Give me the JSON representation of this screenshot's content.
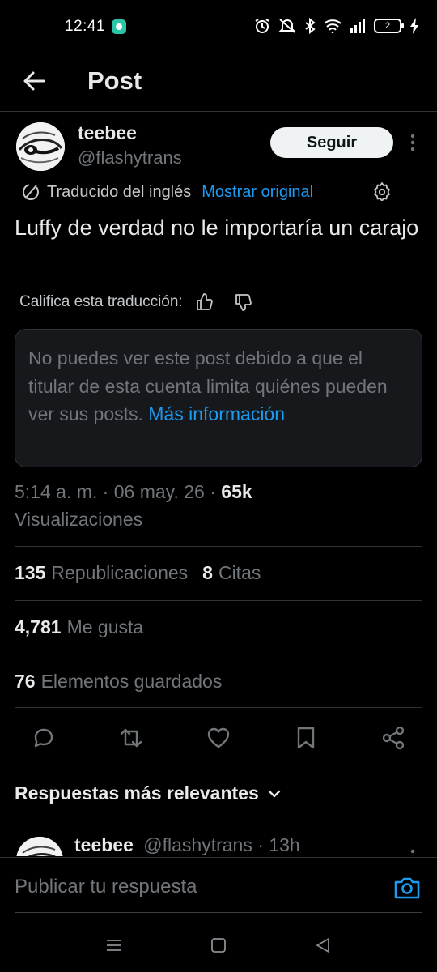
{
  "status_bar": {
    "time": "12:41",
    "battery_level": "2",
    "icons": [
      "app-notification-icon",
      "alarm-icon",
      "mute-icon",
      "bluetooth-icon",
      "wifi-icon",
      "signal-icon",
      "battery-icon",
      "charging-icon"
    ]
  },
  "header": {
    "title": "Post",
    "back_icon": "arrow-left-icon"
  },
  "post": {
    "author_name": "teebee",
    "author_handle": "@flashytrans",
    "follow_label": "Seguir",
    "translated_label": "Traducido del inglés",
    "show_original_label": "Mostrar original",
    "text": "Luffy de verdad no le importaría un carajo",
    "rate_label": "Califica esta traducción:",
    "notice_text": "No puedes ver este post debido a que el titular de esta cuenta limita quiénes pueden ver sus posts.",
    "notice_link": "Más información",
    "time": "5:14 a. m.",
    "date": "06 may. 26",
    "views_count": "65k",
    "views_label": "Visualizaciones"
  },
  "stats": {
    "reposts_count": "135",
    "reposts_label": "Republicaciones",
    "quotes_count": "8",
    "quotes_label": "Citas",
    "likes_count": "4,781",
    "likes_label": "Me gusta",
    "bookmarks_count": "76",
    "bookmarks_label": "Elementos guardados"
  },
  "actions": [
    "reply-icon",
    "repost-icon",
    "like-icon",
    "bookmark-icon",
    "share-icon"
  ],
  "replies": {
    "sort_label": "Respuestas más relevantes",
    "first_reply": {
      "author_name": "teebee",
      "author_handle": "@flashytrans",
      "age": "· 13h"
    }
  },
  "compose": {
    "placeholder": "Publicar tu respuesta"
  },
  "colors": {
    "background": "#000000",
    "text_primary": "#e7e9ea",
    "text_secondary": "#71767b",
    "link": "#1d9bf0",
    "border": "#2f3336"
  }
}
